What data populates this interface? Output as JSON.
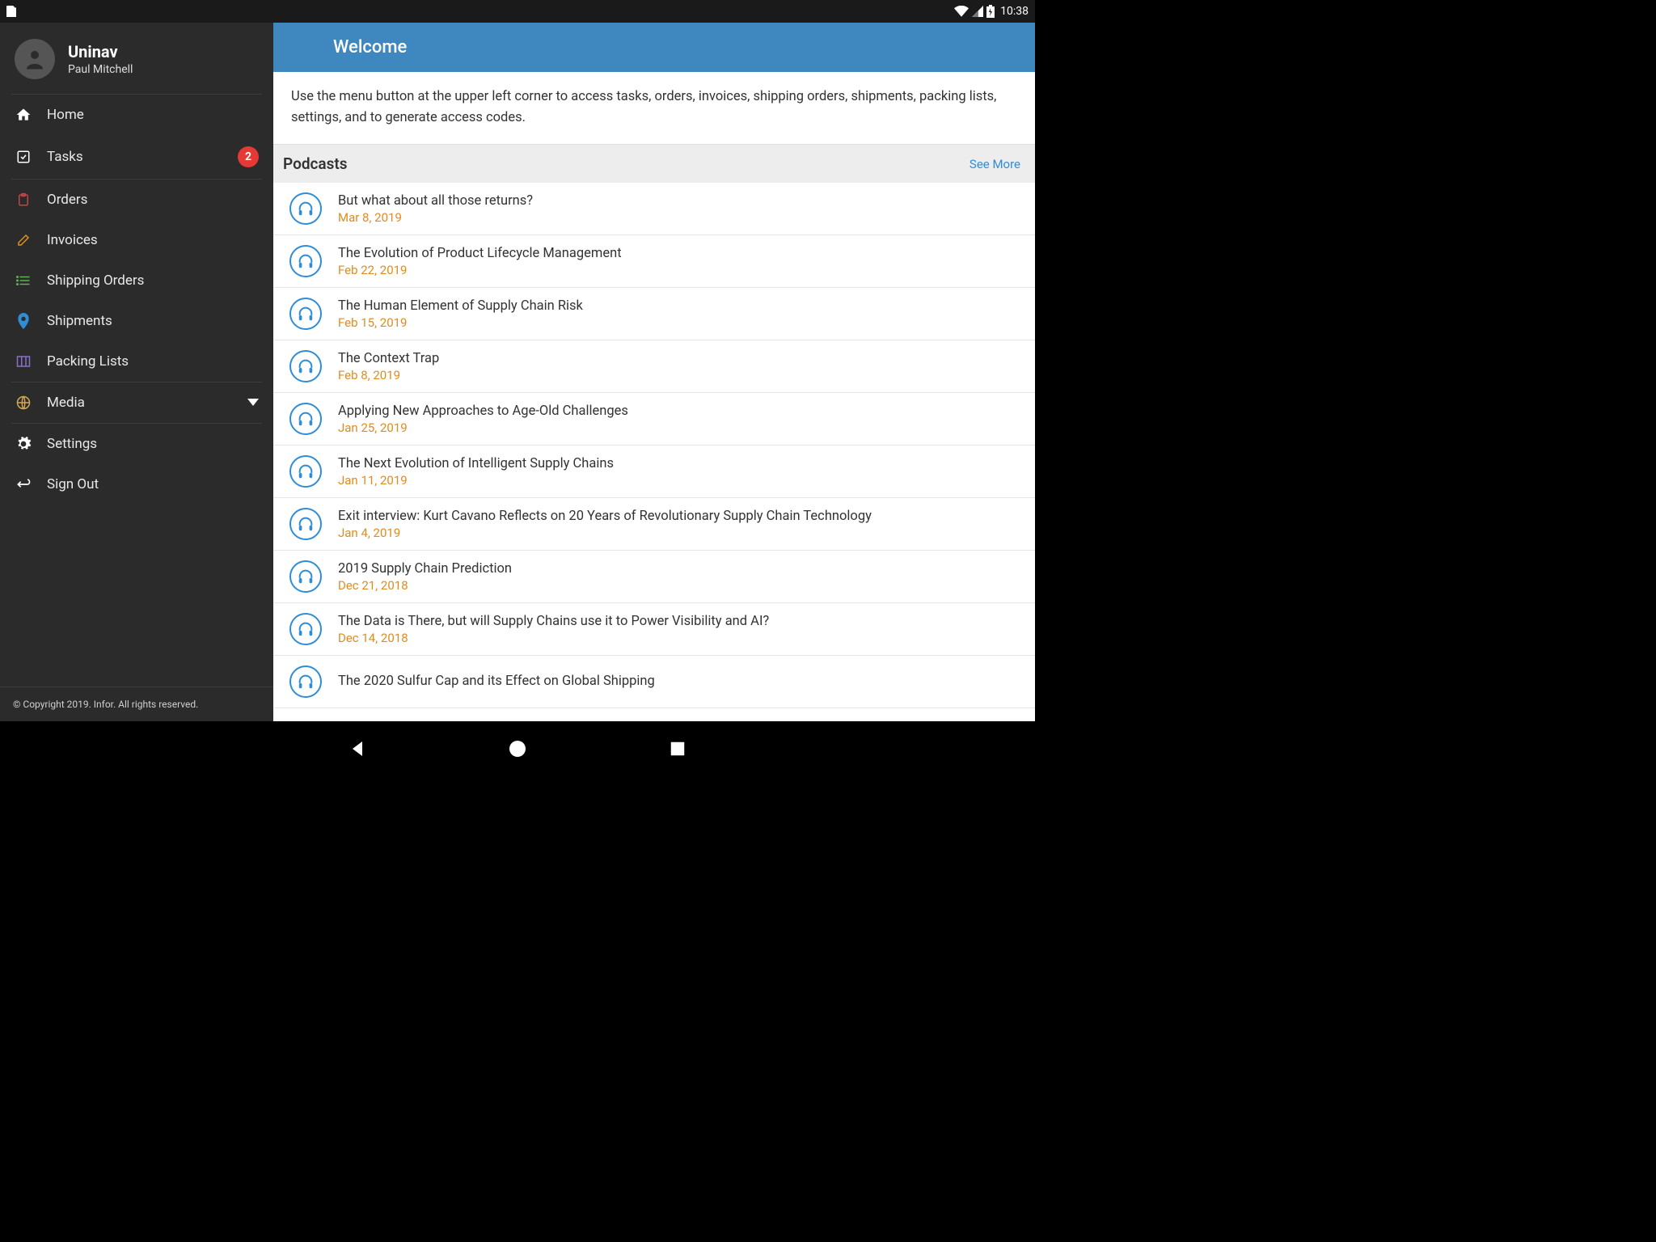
{
  "status": {
    "time": "10:38"
  },
  "profile": {
    "app": "Uninav",
    "user": "Paul Mitchell"
  },
  "sidebar": {
    "home": "Home",
    "tasks": "Tasks",
    "tasks_badge": "2",
    "orders": "Orders",
    "invoices": "Invoices",
    "shipping_orders": "Shipping Orders",
    "shipments": "Shipments",
    "packing_lists": "Packing Lists",
    "media": "Media",
    "settings": "Settings",
    "sign_out": "Sign Out"
  },
  "copyright": "© Copyright 2019. Infor. All rights reserved.",
  "header": {
    "title": "Welcome"
  },
  "intro": "Use the menu button at the upper left corner to access tasks, orders, invoices, shipping orders, shipments, packing lists, settings, and to generate access codes.",
  "podcasts": {
    "heading": "Podcasts",
    "see_more": "See More",
    "items": [
      {
        "title": "But what about all those returns?",
        "date": "Mar 8, 2019"
      },
      {
        "title": "The Evolution of Product Lifecycle Management",
        "date": "Feb 22, 2019"
      },
      {
        "title": "The Human Element of Supply Chain Risk",
        "date": "Feb 15, 2019"
      },
      {
        "title": "The Context Trap",
        "date": "Feb 8, 2019"
      },
      {
        "title": "Applying New Approaches to Age-Old Challenges",
        "date": "Jan 25, 2019"
      },
      {
        "title": "The Next Evolution of Intelligent Supply Chains",
        "date": "Jan 11, 2019"
      },
      {
        "title": "Exit interview: Kurt Cavano Reflects on 20 Years of Revolutionary Supply Chain Technology",
        "date": "Jan 4, 2019"
      },
      {
        "title": "2019 Supply Chain Prediction",
        "date": "Dec 21, 2018"
      },
      {
        "title": "The Data is There, but will Supply Chains use it to Power Visibility and AI?",
        "date": "Dec 14, 2018"
      },
      {
        "title": "The 2020 Sulfur Cap and its Effect on Global Shipping",
        "date": ""
      }
    ]
  }
}
